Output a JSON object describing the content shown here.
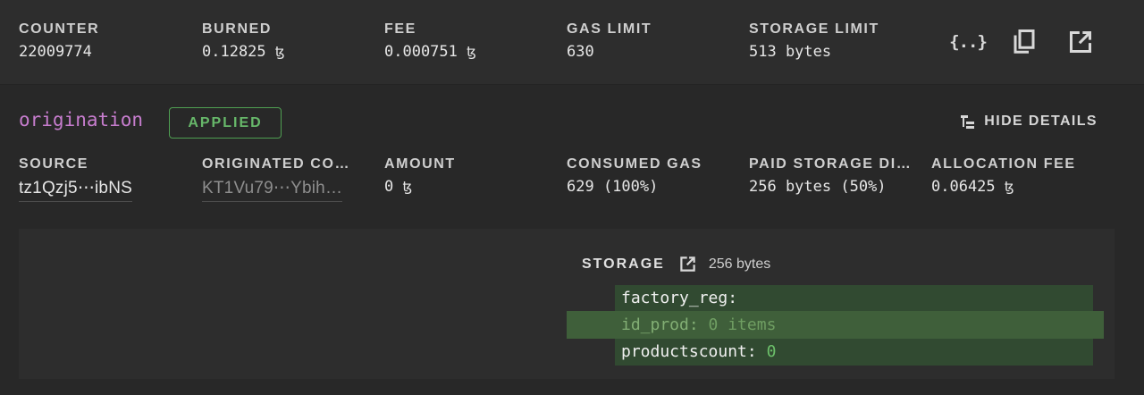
{
  "header_fields": [
    {
      "label": "COUNTER",
      "value": "22009774"
    },
    {
      "label": "BURNED",
      "value": "0.12825",
      "unit": "ꜩ"
    },
    {
      "label": "FEE",
      "value": "0.000751",
      "unit": "ꜩ"
    },
    {
      "label": "GAS LIMIT",
      "value": "630"
    },
    {
      "label": "STORAGE LIMIT",
      "value": "513 bytes"
    }
  ],
  "header_actions": [
    {
      "name": "raw-json-icon",
      "glyph": "{..}"
    },
    {
      "name": "copy-icon"
    },
    {
      "name": "open-external-icon"
    }
  ],
  "operation": {
    "kind": "origination",
    "status": "APPLIED",
    "hide_details_label": "HIDE DETAILS"
  },
  "detail_fields": [
    {
      "label": "SOURCE",
      "value": "tz1Qzj5⋯ibNS"
    },
    {
      "label": "ORIGINATED CO…",
      "value": "KT1Vu79⋯Ybih…"
    },
    {
      "label": "AMOUNT",
      "value": "0",
      "unit": "ꜩ"
    },
    {
      "label": "CONSUMED GAS",
      "value": "629 (100%)"
    },
    {
      "label": "PAID STORAGE DI…",
      "value": "256 bytes (50%)"
    },
    {
      "label": "ALLOCATION FEE",
      "value": "0.06425",
      "unit": "ꜩ"
    }
  ],
  "storage": {
    "title": "STORAGE",
    "size": "256 bytes",
    "lines": [
      {
        "key": "factory_reg:",
        "value": ""
      },
      {
        "key": "id_prod:",
        "value": "0 items"
      },
      {
        "key": "productscount:",
        "value": "0"
      }
    ]
  },
  "colors": {
    "accent_purple": "#c77dce",
    "applied_green": "#67b86a",
    "storage_bg": "#314a31",
    "storage_highlight": "#3f5f3a"
  }
}
